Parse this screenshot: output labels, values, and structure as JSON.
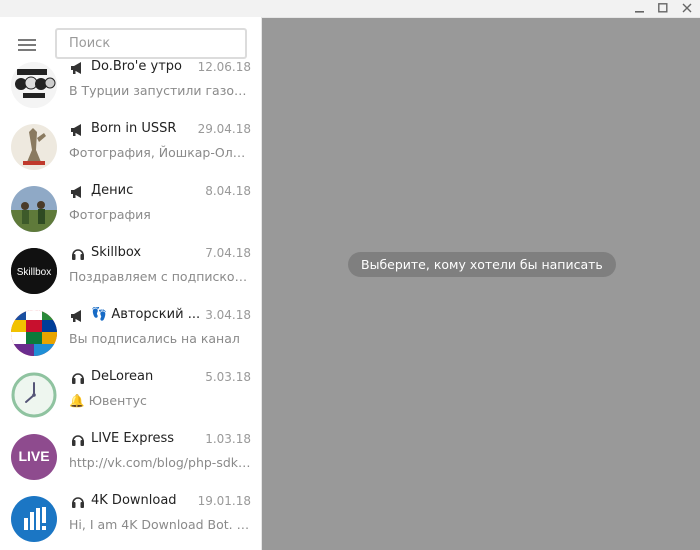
{
  "search": {
    "placeholder": "Поиск"
  },
  "chats": [
    {
      "title": "Do.Bro'e утро",
      "date": "12.06.18",
      "preview": "В Турции запустили газопр...",
      "type": "channel",
      "avatar": "dobroe-utro"
    },
    {
      "title": "Born in USSR",
      "date": "29.04.18",
      "preview": "Фотография, Йошкар-Ола, ...",
      "type": "channel",
      "avatar": "born-in-ussr"
    },
    {
      "title": "Денис",
      "date": "8.04.18",
      "preview": "Фотография",
      "type": "channel",
      "avatar": "denis"
    },
    {
      "title": "Skillbox",
      "date": "7.04.18",
      "preview": "Поздравляем с подпиской ...",
      "type": "bot",
      "avatar": "skillbox",
      "avatar_text": "Skillbox"
    },
    {
      "title": "Авторский ...",
      "title_emoji": "👣",
      "date": "3.04.18",
      "preview": "Вы подписались на канал",
      "type": "channel",
      "avatar": "flags"
    },
    {
      "title": "DeLorean",
      "date": "5.03.18",
      "preview": "Ювентус",
      "preview_emoji": "🔔",
      "type": "bot",
      "avatar": "clock"
    },
    {
      "title": "LIVE Express",
      "date": "1.03.18",
      "preview": "http://vk.com/blog/php-sdk-...",
      "type": "bot",
      "avatar": "live",
      "avatar_text": "LIVE"
    },
    {
      "title": "4K Download",
      "date": "19.01.18",
      "preview": "Hi, I am 4K Download Bot. I c...",
      "type": "bot",
      "avatar": "4k-download"
    }
  ],
  "main": {
    "empty_message": "Выберите, кому хотели бы написать"
  },
  "colors": {
    "main_background": "#999999",
    "skillbox_avatar": "#111111",
    "live_avatar": "#8e4b8e",
    "download_avatar": "#1b76c4"
  }
}
